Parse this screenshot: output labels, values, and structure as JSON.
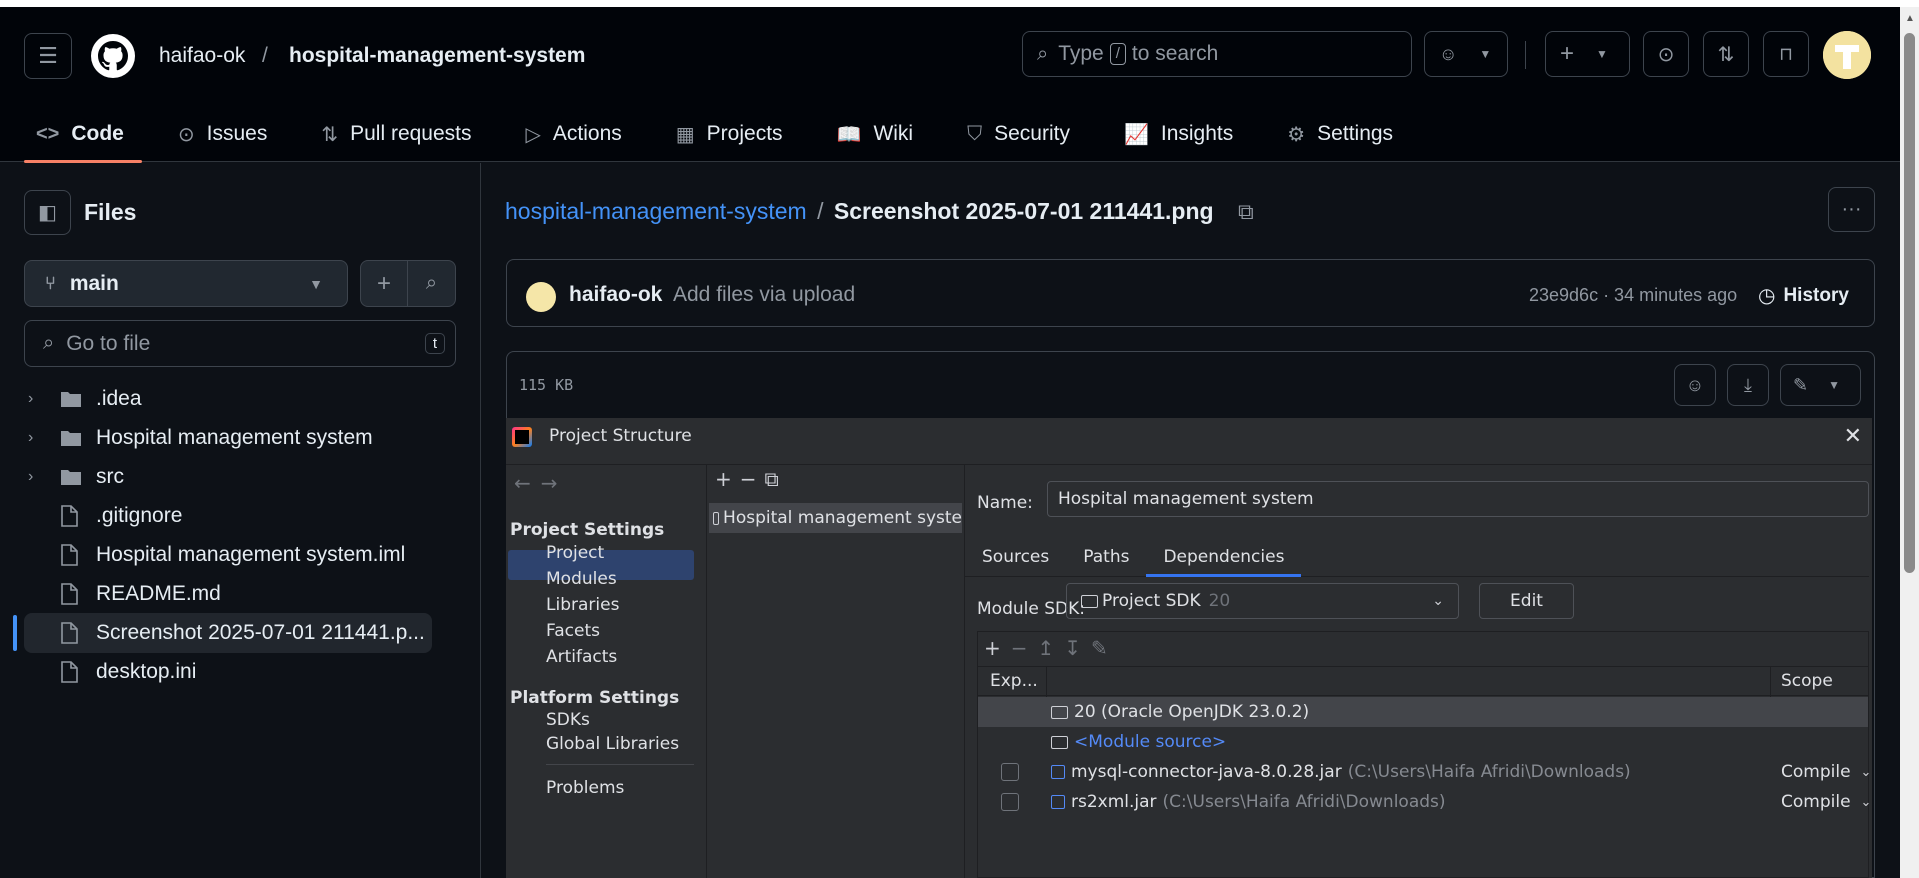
{
  "header": {
    "owner": "haifao-ok",
    "separator": "/",
    "repo": "hospital-management-system",
    "search_prefix": "Type",
    "search_key": "/",
    "search_suffix": "to search"
  },
  "nav": [
    {
      "label": "Code",
      "icon": "code-icon",
      "glyph": "<>"
    },
    {
      "label": "Issues",
      "icon": "issue-icon",
      "glyph": "⊙"
    },
    {
      "label": "Pull requests",
      "icon": "pull-request-icon",
      "glyph": "⇅"
    },
    {
      "label": "Actions",
      "icon": "play-icon",
      "glyph": "▷"
    },
    {
      "label": "Projects",
      "icon": "table-icon",
      "glyph": "▦"
    },
    {
      "label": "Wiki",
      "icon": "book-icon",
      "glyph": "📖"
    },
    {
      "label": "Security",
      "icon": "shield-icon",
      "glyph": "⛉"
    },
    {
      "label": "Insights",
      "icon": "graph-icon",
      "glyph": "📈"
    },
    {
      "label": "Settings",
      "icon": "gear-icon",
      "glyph": "⚙"
    }
  ],
  "sidebar": {
    "title": "Files",
    "branch": "main",
    "goto_placeholder": "Go to file",
    "goto_key": "t",
    "tree": [
      {
        "name": ".idea",
        "type": "folder"
      },
      {
        "name": "Hospital management system",
        "type": "folder"
      },
      {
        "name": "src",
        "type": "folder"
      },
      {
        "name": ".gitignore",
        "type": "file"
      },
      {
        "name": "Hospital management system.iml",
        "type": "file"
      },
      {
        "name": "README.md",
        "type": "file"
      },
      {
        "name": "Screenshot 2025-07-01 211441.p...",
        "type": "file",
        "selected": true
      },
      {
        "name": "desktop.ini",
        "type": "file"
      }
    ]
  },
  "breadcrumb": {
    "repo": "hospital-management-system",
    "sep": "/",
    "file": "Screenshot 2025-07-01 211441.png"
  },
  "commit": {
    "author": "haifao-ok",
    "message": "Add files via upload",
    "meta": "23e9d6c · 34 minutes ago",
    "history": "History"
  },
  "viewer": {
    "size": "115 KB"
  },
  "ij": {
    "title": "Project Structure",
    "project_settings": "Project Settings",
    "left_items_a": [
      "Project",
      "Modules",
      "Libraries",
      "Facets",
      "Artifacts"
    ],
    "platform_settings": "Platform Settings",
    "left_items_b": [
      "SDKs",
      "Global Libraries"
    ],
    "problems": "Problems",
    "module": "Hospital management syste",
    "name_label": "Name:",
    "name_value": "Hospital management system",
    "tabs": [
      "Sources",
      "Paths",
      "Dependencies"
    ],
    "sdk_label": "Module SDK:",
    "sdk_value": "Project SDK",
    "sdk_version": "20",
    "edit": "Edit",
    "col_export": "Exp...",
    "col_scope": "Scope",
    "rows": [
      {
        "name": "20 (Oracle OpenJDK 23.0.2)",
        "path": "",
        "scope": "",
        "checkbox": false
      },
      {
        "name": "<Module source>",
        "path": "",
        "scope": "",
        "checkbox": false
      },
      {
        "name": "mysql-connector-java-8.0.28.jar",
        "path": "(C:\\Users\\Haifa Afridi\\Downloads)",
        "scope": "Compile",
        "checkbox": true
      },
      {
        "name": "rs2xml.jar",
        "path": "(C:\\Users\\Haifa Afridi\\Downloads)",
        "scope": "Compile",
        "checkbox": true
      }
    ]
  }
}
